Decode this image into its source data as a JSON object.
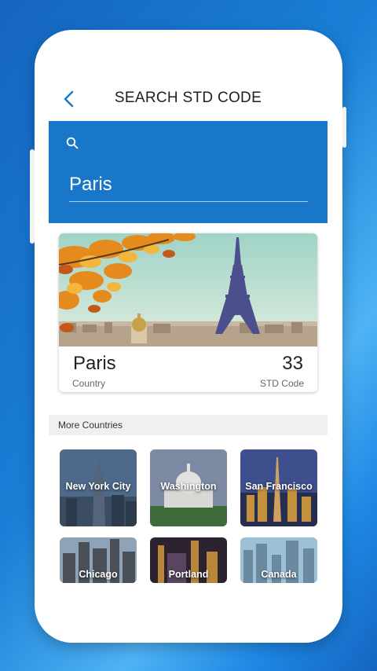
{
  "header": {
    "title": "SEARCH STD CODE",
    "back_icon": "chevron-left-icon"
  },
  "search": {
    "value": "Paris",
    "icon": "search-icon"
  },
  "result": {
    "city": "Paris",
    "city_sub": "Country",
    "code": "33",
    "code_label": "STD Code"
  },
  "more": {
    "title": "More Countries",
    "items": [
      {
        "label": "New York City"
      },
      {
        "label": "Washington"
      },
      {
        "label": "San Francisco"
      },
      {
        "label": "Chicago"
      },
      {
        "label": "Portland"
      },
      {
        "label": "Canada"
      }
    ]
  },
  "colors": {
    "accent": "#1877c9",
    "background": "#1a7fd6"
  }
}
